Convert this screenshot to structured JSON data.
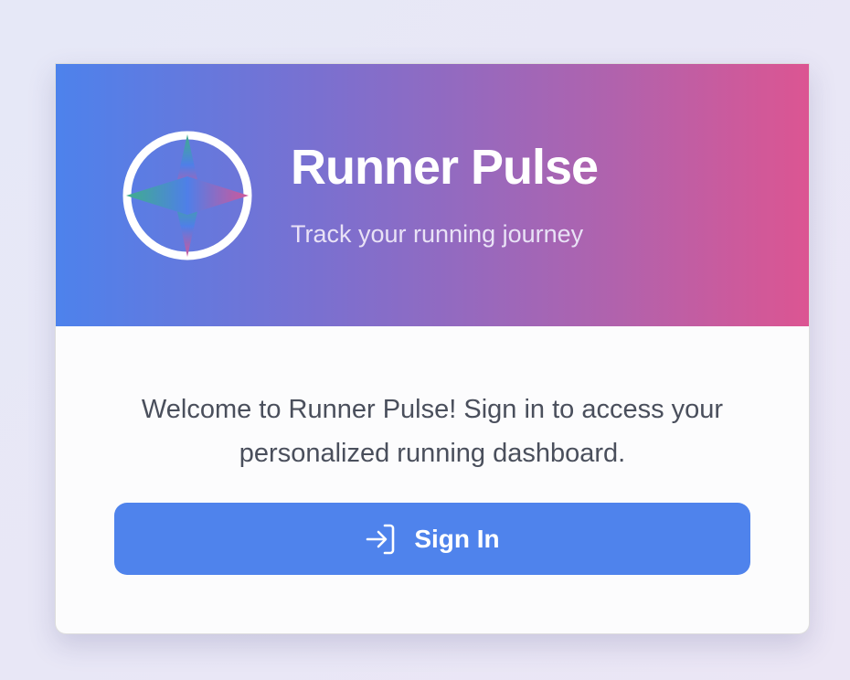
{
  "app": {
    "title": "Runner Pulse",
    "subtitle": "Track your running journey",
    "logo_icon": "compass-icon"
  },
  "main": {
    "welcome": "Welcome to Runner Pulse! Sign in to access your personalized running dashboard.",
    "sign_in_label": "Sign In",
    "sign_in_icon": "sign-in-icon"
  },
  "colors": {
    "accent": "#4f83ec",
    "gradient_start": "#4d82ec",
    "gradient_end": "#dc5592"
  }
}
